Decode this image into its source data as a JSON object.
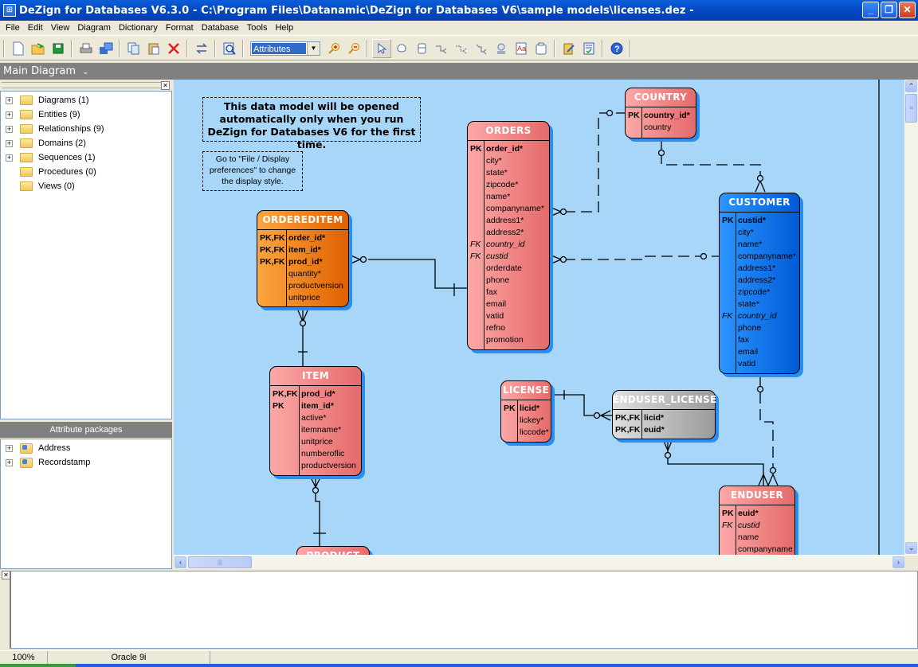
{
  "window": {
    "title": "DeZign for Databases V6.3.0 - C:\\Program Files\\Datanamic\\DeZign for Databases V6\\sample models\\licenses.dez -",
    "minimize": "_",
    "restore": "❐",
    "close": "✕"
  },
  "menu": [
    "File",
    "Edit",
    "View",
    "Diagram",
    "Dictionary",
    "Format",
    "Database",
    "Tools",
    "Help"
  ],
  "toolbar": {
    "buttons": [
      "new-icon",
      "open-icon",
      "save-icon",
      "print-icon",
      "export-icon",
      "copy-icon",
      "paste-icon",
      "delete-icon",
      "swap-icon",
      "preview-icon"
    ],
    "display_mode": "Attributes",
    "tools": [
      "zoom-in-icon",
      "zoom-out-icon",
      "pointer-icon",
      "hand-icon",
      "entity-icon",
      "relationship-icon",
      "non-identifying-relationship-icon",
      "self-relationship-icon",
      "subtype-icon",
      "note-icon",
      "page-icon",
      "generate-icon",
      "check-icon",
      "help-icon"
    ]
  },
  "diagram_tab": {
    "label": "Main Diagram",
    "dropdown": "⌄"
  },
  "tree": {
    "items": [
      {
        "label": "Diagrams (1)",
        "expandable": true
      },
      {
        "label": "Entities (9)",
        "expandable": true
      },
      {
        "label": "Relationships (9)",
        "expandable": true
      },
      {
        "label": "Domains (2)",
        "expandable": true
      },
      {
        "label": "Sequences (1)",
        "expandable": true
      },
      {
        "label": "Procedures (0)",
        "expandable": false
      },
      {
        "label": "Views (0)",
        "expandable": false
      }
    ]
  },
  "attribute_packages": {
    "title": "Attribute packages",
    "items": [
      {
        "label": "Address"
      },
      {
        "label": "Recordstamp"
      }
    ]
  },
  "notes": {
    "main": "This data model will be opened automatically only when you run DeZign for Databases V6 for the first time.",
    "hint": "Go to \"File / Display preferences\" to change the display style."
  },
  "entities": {
    "country": {
      "name": "COUNTRY",
      "keys": [
        "PK",
        ""
      ],
      "attrs": [
        "country_id*",
        "country"
      ]
    },
    "orders": {
      "name": "ORDERS",
      "keys": [
        "PK",
        "",
        "",
        "",
        "",
        "",
        "",
        "",
        "FK",
        "FK",
        "",
        "",
        "",
        "",
        "",
        "",
        ""
      ],
      "attrs": [
        "order_id*",
        "city*",
        "state*",
        "zipcode*",
        "name*",
        "companyname*",
        "address1*",
        "address2*",
        "country_id",
        "custid",
        "orderdate",
        "phone",
        "fax",
        "email",
        "vatid",
        "refno",
        "promotion"
      ]
    },
    "ordereditem": {
      "name": "ORDEREDITEM",
      "keys": [
        "PK,FK",
        "PK,FK",
        "PK,FK",
        "",
        "",
        ""
      ],
      "attrs": [
        "order_id*",
        "item_id*",
        "prod_id*",
        "quantity*",
        "productversion",
        "unitprice"
      ]
    },
    "customer": {
      "name": "CUSTOMER",
      "keys": [
        "PK",
        "",
        "",
        "",
        "",
        "",
        "",
        "",
        "FK",
        "",
        "",
        "",
        ""
      ],
      "attrs": [
        "custid*",
        "city*",
        "name*",
        "companyname*",
        "address1*",
        "address2*",
        "zipcode*",
        "state*",
        "country_id",
        "phone",
        "fax",
        "email",
        "vatid"
      ]
    },
    "item": {
      "name": "ITEM",
      "keys": [
        "PK,FK",
        "PK",
        "",
        "",
        "",
        "",
        ""
      ],
      "attrs": [
        "prod_id*",
        "item_id*",
        "active*",
        "itemname*",
        "unitprice",
        "numberoflic",
        "productversion"
      ]
    },
    "license": {
      "name": "LICENSE",
      "keys": [
        "PK",
        "",
        ""
      ],
      "attrs": [
        "licid*",
        "lickey*",
        "liccode*"
      ]
    },
    "enduser_license": {
      "name": "ENDUSER_LICENSE",
      "keys": [
        "PK,FK",
        "PK,FK"
      ],
      "attrs": [
        "licid*",
        "euid*"
      ]
    },
    "enduser": {
      "name": "ENDUSER",
      "keys": [
        "PK",
        "FK",
        "",
        ""
      ],
      "attrs": [
        "euid*",
        "custid",
        "name",
        "companyname"
      ]
    },
    "product": {
      "name": "PRODUCT"
    }
  },
  "status": {
    "zoom": "100%",
    "database": "Oracle 9i",
    "message": ""
  }
}
